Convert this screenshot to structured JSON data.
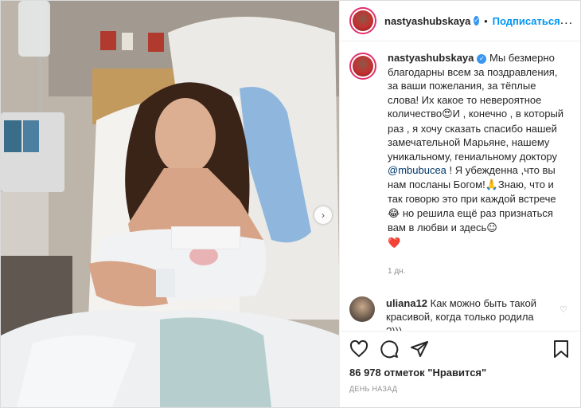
{
  "post": {
    "username": "nastyashubskaya",
    "follow_label": "Подписаться",
    "separator": "•",
    "more_label": "...",
    "next_label": "›"
  },
  "caption": {
    "username": "nastyashubskaya",
    "text_part1": " Мы безмерно благодарны всем за поздравления, за ваши пожелания, за тёплые слова! Их какое то невероятное количество",
    "emoji1": "😍",
    "text_part2": "И , конечно , в который раз , я хочу сказать спасибо нашей замечательной Марьяне, нашему уникальному, гениальному доктору ",
    "mention": "@mbubucea",
    "text_part3": " ! Я убежденна ,что вы нам посланы Богом!",
    "emoji2": "🙏",
    "text_part4": "Знаю, что и так говорю это при каждой встрече",
    "emoji3": "😂",
    "text_part5": " но решила ещё раз признаться вам в любви и здесь",
    "emoji4": "☺",
    "emoji5": "❤️",
    "age": "1 дн."
  },
  "comment": {
    "username": "uliana12",
    "text": " Как можно быть такой красивой, когда только родила ?)))",
    "like_icon": "♡"
  },
  "footer": {
    "likes": "86 978 отметок \"Нравится\"",
    "date": "ДЕНЬ НАЗАД"
  },
  "icons": {
    "like": "heart-icon",
    "comment": "comment-icon",
    "share": "share-icon",
    "save": "bookmark-icon",
    "verified": "verified-icon"
  },
  "colors": {
    "accent": "#0095f6",
    "verified": "#3897f0",
    "mention": "#00376b",
    "muted": "#8e8e8e"
  }
}
